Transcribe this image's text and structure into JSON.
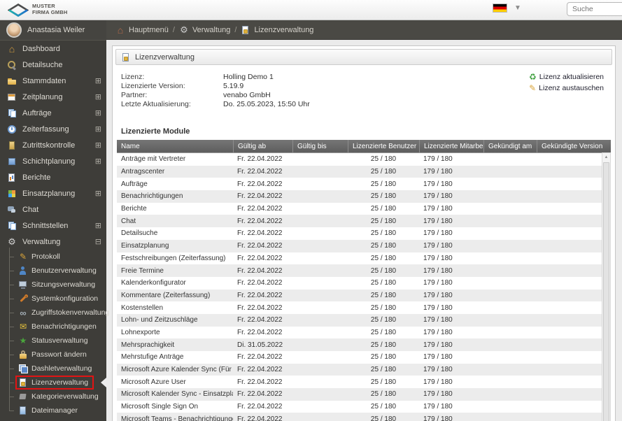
{
  "topbar": {
    "logo_line1": "MUSTER",
    "logo_line2": "FIRMA GMBH",
    "language": "de",
    "search_placeholder": "Suche"
  },
  "breadcrumb": {
    "separator": "/",
    "items": [
      {
        "label": "Hauptmenü",
        "icon": "home-icon"
      },
      {
        "label": "Verwaltung",
        "icon": "gear-icon"
      },
      {
        "label": "Lizenzverwaltung",
        "icon": "license-icon"
      }
    ]
  },
  "sidebar": {
    "user": {
      "name": "Anastasia Weiler"
    },
    "items": [
      {
        "label": "Dashboard",
        "icon": "house",
        "icon_color": "#cf9a3d",
        "expander": null
      },
      {
        "label": "Detailsuche",
        "icon": "search",
        "icon_color": "#b9a05a",
        "expander": null
      },
      {
        "label": "Stammdaten",
        "icon": "folder",
        "icon_color": "#e0ae45",
        "expander": "plus"
      },
      {
        "label": "Zeitplanung",
        "icon": "cal",
        "icon_color": "#e09c3a",
        "expander": "plus"
      },
      {
        "label": "Aufträge",
        "icon": "pages",
        "icon_color": "#7fa9d8",
        "expander": "plus"
      },
      {
        "label": "Zeiterfassung",
        "icon": "clock",
        "icon_color": "#6f9bd1",
        "expander": "plus"
      },
      {
        "label": "Zutrittskontrolle",
        "icon": "door",
        "icon_color": "#c9a34a",
        "expander": "plus"
      },
      {
        "label": "Schichtplanung",
        "icon": "square",
        "icon_color": "#6f9bd1",
        "expander": "plus"
      },
      {
        "label": "Berichte",
        "icon": "report",
        "icon_color": "#d9822b",
        "expander": null
      },
      {
        "label": "Einsatzplanung",
        "icon": "grid",
        "icon_color": "#7cb342",
        "expander": "plus"
      },
      {
        "label": "Chat",
        "icon": "chat",
        "icon_color": "#8fa3b8",
        "expander": null
      },
      {
        "label": "Schnittstellen",
        "icon": "pages",
        "icon_color": "#7fa9d8",
        "expander": "plus"
      },
      {
        "label": "Verwaltung",
        "icon": "gear",
        "icon_color": "#cfcfcf",
        "expander": "minus"
      }
    ],
    "admin_submenu": [
      {
        "label": "Protokoll",
        "icon": "pencil",
        "icon_color": "#d9a43b",
        "selected": false
      },
      {
        "label": "Benutzerverwaltung",
        "icon": "person",
        "icon_color": "#4f86c6",
        "selected": false
      },
      {
        "label": "Sitzungsverwaltung",
        "icon": "monitor",
        "icon_color": "#8fa3b8",
        "selected": false
      },
      {
        "label": "Systemkonfiguration",
        "icon": "wrench",
        "icon_color": "#d07b2a",
        "selected": false
      },
      {
        "label": "Zugriffstokenverwaltung",
        "icon": "inf",
        "icon_color": "#a3adb5",
        "selected": false
      },
      {
        "label": "Benachrichtigungen",
        "icon": "mail",
        "icon_color": "#e6c23c",
        "selected": false
      },
      {
        "label": "Statusverwaltung",
        "icon": "star",
        "icon_color": "#4aa53c",
        "selected": false
      },
      {
        "label": "Passwort ändern",
        "icon": "lock",
        "icon_color": "#d9a43b",
        "selected": false
      },
      {
        "label": "Dashletverwaltung",
        "icon": "stack",
        "icon_color": "#5b87c5",
        "selected": false
      },
      {
        "label": "Lizenzverwaltung",
        "icon": "doc",
        "icon_color": "#e0b23c",
        "selected": true
      },
      {
        "label": "Kategorieverwaltung",
        "icon": "tag",
        "icon_color": "#9a9a9a",
        "selected": false
      },
      {
        "label": "Dateimanager",
        "icon": "file",
        "icon_color": "#6f9bd1",
        "selected": false
      }
    ]
  },
  "panel": {
    "title": "Lizenzverwaltung",
    "info": [
      {
        "label": "Lizenz:",
        "value": "Holling Demo 1"
      },
      {
        "label": "Lizenzierte Version:",
        "value": "5.19.9"
      },
      {
        "label": "Partner:",
        "value": "venabo GmbH"
      },
      {
        "label": "Letzte Aktualisierung:",
        "value": "Do. 25.05.2023, 15:50 Uhr"
      }
    ],
    "actions": [
      {
        "label": "Lizenz aktualisieren",
        "icon": "refresh-icon",
        "icon_glyph": "♻",
        "icon_color": "#3a9d3a"
      },
      {
        "label": "Lizenz austauschen",
        "icon": "edit-icon",
        "icon_glyph": "✎",
        "icon_color": "#d9a43b"
      }
    ],
    "section_title": "Lizenzierte Module",
    "table": {
      "columns": [
        "Name",
        "Gültig ab",
        "Gültig bis",
        "Lizenzierte Benutzer",
        "Lizenzierte Mitarbeiter",
        "Gekündigt am",
        "Gekündigte Version"
      ],
      "rows": [
        [
          "Anträge mit Vertreter",
          "Fr. 22.04.2022",
          "",
          "25 / 180",
          "179 / 180",
          "",
          ""
        ],
        [
          "Antragscenter",
          "Fr. 22.04.2022",
          "",
          "25 / 180",
          "179 / 180",
          "",
          ""
        ],
        [
          "Aufträge",
          "Fr. 22.04.2022",
          "",
          "25 / 180",
          "179 / 180",
          "",
          ""
        ],
        [
          "Benachrichtigungen",
          "Fr. 22.04.2022",
          "",
          "25 / 180",
          "179 / 180",
          "",
          ""
        ],
        [
          "Berichte",
          "Fr. 22.04.2022",
          "",
          "25 / 180",
          "179 / 180",
          "",
          ""
        ],
        [
          "Chat",
          "Fr. 22.04.2022",
          "",
          "25 / 180",
          "179 / 180",
          "",
          ""
        ],
        [
          "Detailsuche",
          "Fr. 22.04.2022",
          "",
          "25 / 180",
          "179 / 180",
          "",
          ""
        ],
        [
          "Einsatzplanung",
          "Fr. 22.04.2022",
          "",
          "25 / 180",
          "179 / 180",
          "",
          ""
        ],
        [
          "Festschreibungen (Zeiterfassung)",
          "Fr. 22.04.2022",
          "",
          "25 / 180",
          "179 / 180",
          "",
          ""
        ],
        [
          "Freie Termine",
          "Fr. 22.04.2022",
          "",
          "25 / 180",
          "179 / 180",
          "",
          ""
        ],
        [
          "Kalenderkonfigurator",
          "Fr. 22.04.2022",
          "",
          "25 / 180",
          "179 / 180",
          "",
          ""
        ],
        [
          "Kommentare (Zeiterfassung)",
          "Fr. 22.04.2022",
          "",
          "25 / 180",
          "179 / 180",
          "",
          ""
        ],
        [
          "Kostenstellen",
          "Fr. 22.04.2022",
          "",
          "25 / 180",
          "179 / 180",
          "",
          ""
        ],
        [
          "Lohn- und Zeitzuschläge",
          "Fr. 22.04.2022",
          "",
          "25 / 180",
          "179 / 180",
          "",
          ""
        ],
        [
          "Lohnexporte",
          "Fr. 22.04.2022",
          "",
          "25 / 180",
          "179 / 180",
          "",
          ""
        ],
        [
          "Mehrsprachigkeit",
          "Di. 31.05.2022",
          "",
          "25 / 180",
          "179 / 180",
          "",
          ""
        ],
        [
          "Mehrstufige Anträge",
          "Fr. 22.04.2022",
          "",
          "25 / 180",
          "179 / 180",
          "",
          ""
        ],
        [
          "Microsoft Azure Kalender Sync (Für den Kaler",
          "Fr. 22.04.2022",
          "",
          "25 / 180",
          "179 / 180",
          "",
          ""
        ],
        [
          "Microsoft Azure User",
          "Fr. 22.04.2022",
          "",
          "25 / 180",
          "179 / 180",
          "",
          ""
        ],
        [
          "Microsoft Kalender Sync - Einsatzplanung",
          "Fr. 22.04.2022",
          "",
          "25 / 180",
          "179 / 180",
          "",
          ""
        ],
        [
          "Microsoft Single Sign On",
          "Fr. 22.04.2022",
          "",
          "25 / 180",
          "179 / 180",
          "",
          ""
        ],
        [
          "Microsoft Teams - Benachrichtigungen",
          "Fr. 22.04.2022",
          "",
          "25 / 180",
          "179 / 180",
          "",
          ""
        ]
      ]
    }
  }
}
